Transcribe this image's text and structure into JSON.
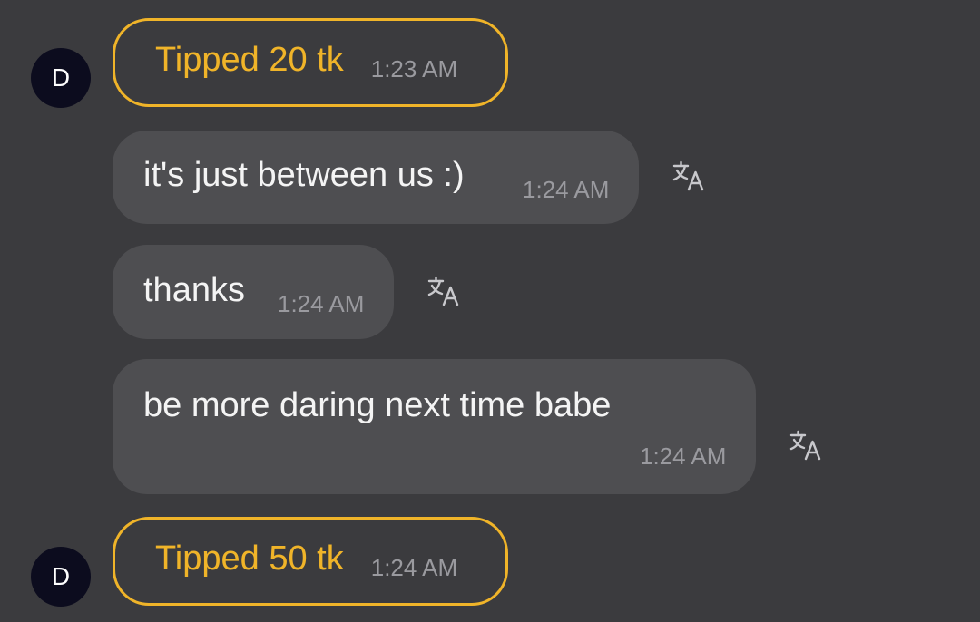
{
  "messages": [
    {
      "type": "tip",
      "avatar": "D",
      "text": "Tipped 20 tk",
      "time": "1:23 AM"
    },
    {
      "type": "text",
      "text": "it's just between us :)",
      "time": "1:24 AM",
      "icon": "translate-icon"
    },
    {
      "type": "text",
      "text": "thanks",
      "time": "1:24 AM",
      "icon": "translate-icon"
    },
    {
      "type": "text",
      "text": "be more daring next time babe",
      "time": "1:24 AM",
      "icon": "translate-icon"
    },
    {
      "type": "tip",
      "avatar": "D",
      "text": "Tipped 50 tk",
      "time": "1:24 AM"
    }
  ],
  "colors": {
    "background": "#3b3b3e",
    "bubble": "#4e4e51",
    "tip_accent": "#f0b429",
    "avatar": "#0c0c1e",
    "timestamp": "#9a9a9f"
  }
}
